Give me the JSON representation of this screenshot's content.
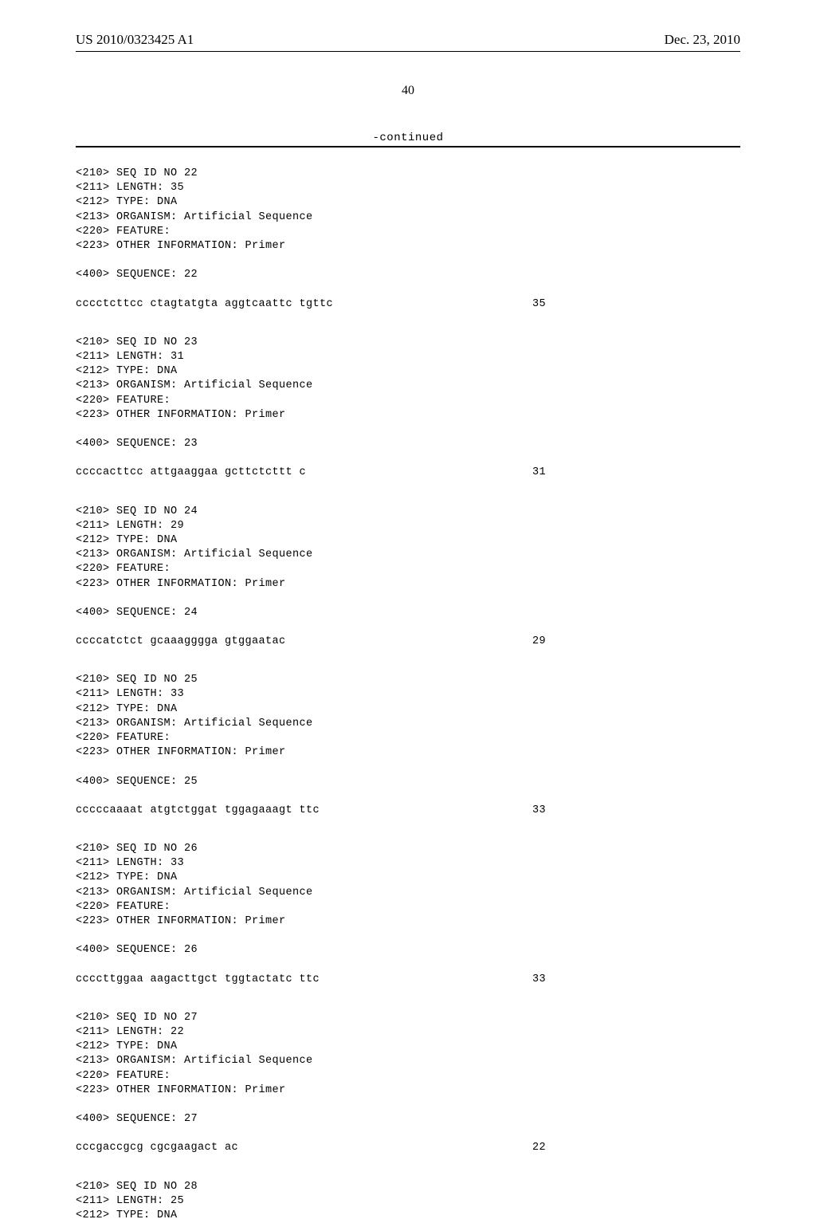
{
  "header": {
    "left": "US 2010/0323425 A1",
    "right": "Dec. 23, 2010"
  },
  "page_number": "40",
  "continued_label": "-continued",
  "blocks": [
    {
      "meta": [
        "<210> SEQ ID NO 22",
        "<211> LENGTH: 35",
        "<212> TYPE: DNA",
        "<213> ORGANISM: Artificial Sequence",
        "<220> FEATURE:",
        "<223> OTHER INFORMATION: Primer"
      ],
      "seq_label": "<400> SEQUENCE: 22",
      "sequence": "cccctcttcc ctagtatgta aggtcaattc tgttc",
      "length": "35"
    },
    {
      "meta": [
        "<210> SEQ ID NO 23",
        "<211> LENGTH: 31",
        "<212> TYPE: DNA",
        "<213> ORGANISM: Artificial Sequence",
        "<220> FEATURE:",
        "<223> OTHER INFORMATION: Primer"
      ],
      "seq_label": "<400> SEQUENCE: 23",
      "sequence": "ccccacttcc attgaaggaa gcttctcttt c",
      "length": "31"
    },
    {
      "meta": [
        "<210> SEQ ID NO 24",
        "<211> LENGTH: 29",
        "<212> TYPE: DNA",
        "<213> ORGANISM: Artificial Sequence",
        "<220> FEATURE:",
        "<223> OTHER INFORMATION: Primer"
      ],
      "seq_label": "<400> SEQUENCE: 24",
      "sequence": "ccccatctct gcaaagggga gtggaatac",
      "length": "29"
    },
    {
      "meta": [
        "<210> SEQ ID NO 25",
        "<211> LENGTH: 33",
        "<212> TYPE: DNA",
        "<213> ORGANISM: Artificial Sequence",
        "<220> FEATURE:",
        "<223> OTHER INFORMATION: Primer"
      ],
      "seq_label": "<400> SEQUENCE: 25",
      "sequence": "cccccaaaat atgtctggat tggagaaagt ttc",
      "length": "33"
    },
    {
      "meta": [
        "<210> SEQ ID NO 26",
        "<211> LENGTH: 33",
        "<212> TYPE: DNA",
        "<213> ORGANISM: Artificial Sequence",
        "<220> FEATURE:",
        "<223> OTHER INFORMATION: Primer"
      ],
      "seq_label": "<400> SEQUENCE: 26",
      "sequence": "ccccttggaa aagacttgct tggtactatc ttc",
      "length": "33"
    },
    {
      "meta": [
        "<210> SEQ ID NO 27",
        "<211> LENGTH: 22",
        "<212> TYPE: DNA",
        "<213> ORGANISM: Artificial Sequence",
        "<220> FEATURE:",
        "<223> OTHER INFORMATION: Primer"
      ],
      "seq_label": "<400> SEQUENCE: 27",
      "sequence": "cccgaccgcg cgcgaagact ac",
      "length": "22"
    },
    {
      "meta": [
        "<210> SEQ ID NO 28",
        "<211> LENGTH: 25",
        "<212> TYPE: DNA"
      ],
      "seq_label": null,
      "sequence": null,
      "length": null
    }
  ]
}
